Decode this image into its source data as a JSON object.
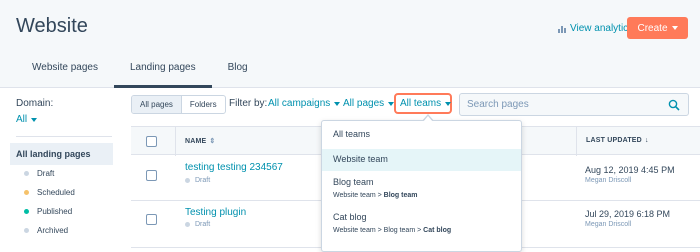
{
  "header": {
    "title": "Website",
    "view_analytics": "View analytics",
    "create_label": "Create"
  },
  "tabs": [
    {
      "label": "Website pages",
      "active": false
    },
    {
      "label": "Landing pages",
      "active": true
    },
    {
      "label": "Blog",
      "active": false
    }
  ],
  "sidebar": {
    "domain_label": "Domain:",
    "domain_value": "All",
    "all_landing_pages": "All landing pages",
    "statuses": [
      {
        "label": "Draft",
        "color": "#cbd6e2"
      },
      {
        "label": "Scheduled",
        "color": "#f5c26b"
      },
      {
        "label": "Published",
        "color": "#00bda5"
      },
      {
        "label": "Archived",
        "color": "#cbd6e2"
      }
    ]
  },
  "toolbar": {
    "all_pages_btn": "All pages",
    "folders_btn": "Folders",
    "filter_by": "Filter by:",
    "all_campaigns": "All campaigns",
    "all_pages": "All pages",
    "all_teams": "All teams",
    "search_placeholder": "Search pages"
  },
  "table": {
    "col_name": "NAME",
    "col_last_updated": "LAST UPDATED",
    "rows": [
      {
        "title": "testing testing 234567",
        "status": "Draft",
        "date": "Aug 12, 2019 4:45 PM",
        "author": "Megan Driscoll"
      },
      {
        "title": "Testing plugin",
        "status": "Draft",
        "date": "Jul 29, 2019 6:18 PM",
        "author": "Megan Driscoll"
      }
    ]
  },
  "teams_dropdown": {
    "items": [
      {
        "name": "All teams",
        "path_prefix": "",
        "path_bold": "",
        "selected": false
      },
      {
        "name": "Website team",
        "path_prefix": "",
        "path_bold": "",
        "selected": true
      },
      {
        "name": "Blog team",
        "path_prefix": "Website team > ",
        "path_bold": "Blog team",
        "selected": false
      },
      {
        "name": "Cat blog",
        "path_prefix": "Website team > Blog team > ",
        "path_bold": "Cat blog",
        "selected": false
      }
    ]
  },
  "colors": {
    "accent": "#ff7a59",
    "link": "#0091ae",
    "text": "#33475b"
  }
}
